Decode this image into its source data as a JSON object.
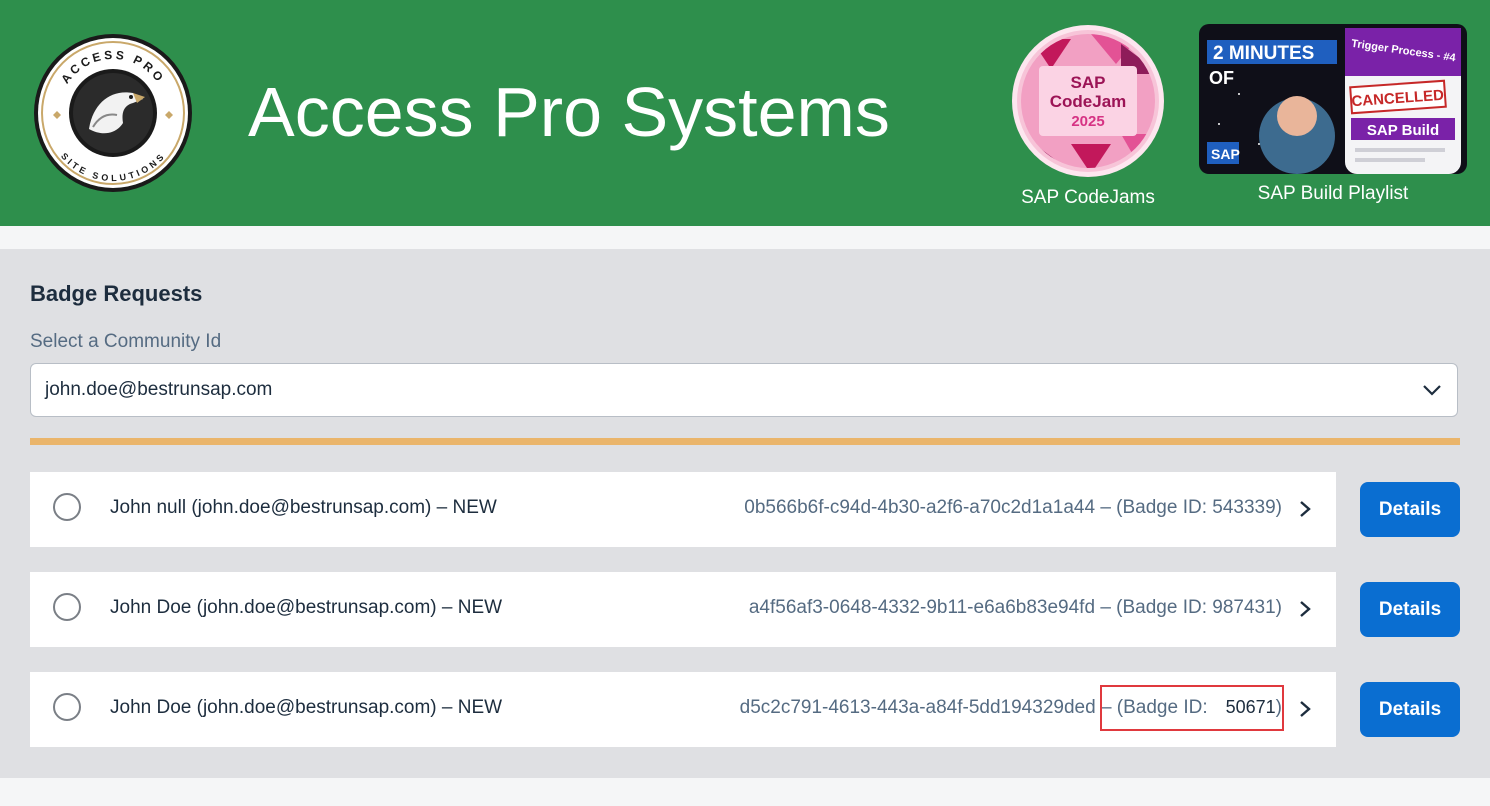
{
  "header": {
    "title": "Access Pro Systems",
    "logo": {
      "ring_top": "ACCESS PRO",
      "ring_bottom": "SITE SOLUTIONS",
      "icon": "hawk-icon"
    },
    "links": [
      {
        "label": "SAP CodeJams",
        "badge_lines": [
          "SAP",
          "CodeJam",
          "2025"
        ]
      },
      {
        "label": "SAP Build Playlist",
        "thumb": {
          "line1": "2 MINUTES",
          "line2": "OF",
          "banner": "Trigger Process - #4",
          "stamp": "CANCELLED",
          "tag": "SAP Build",
          "brand": "SAP"
        }
      }
    ]
  },
  "main": {
    "title": "Badge Requests",
    "select": {
      "label": "Select a Community Id",
      "value": "john.doe@bestrunsap.com"
    },
    "progress": {
      "value": 1.0,
      "color": "#eab56b"
    },
    "requests": [
      {
        "title": "John null (john.doe@bestrunsap.com) – NEW",
        "id": "0b566b6f-c94d-4b30-a2f6-a70c2d1a1a44",
        "badge_prefix": "– (Badge ID: 543339)",
        "button": "Details"
      },
      {
        "title": "John Doe (john.doe@bestrunsap.com) – NEW",
        "id": "a4f56af3-0648-4332-9b11-e6a6b83e94fd",
        "badge_prefix": "– (Badge ID: 987431)",
        "button": "Details"
      },
      {
        "title": "John Doe (john.doe@bestrunsap.com) – NEW",
        "id": "d5c2c791-4613-443a-a84f-5dd194329ded",
        "badge_prefix": "– (Badge ID:",
        "badge_value": "50671",
        "badge_suffix": ")",
        "button": "Details"
      }
    ]
  },
  "colors": {
    "header": "#2e8f4c",
    "button": "#0a6ed1",
    "highlight": "#e0393e"
  }
}
